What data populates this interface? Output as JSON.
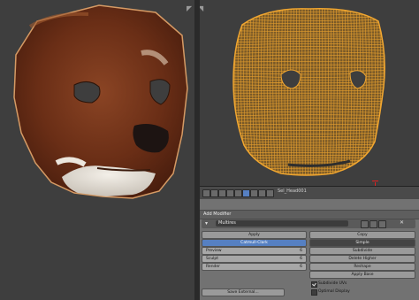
{
  "viewports": {
    "left_corner_icon": "corner-drag-icon",
    "right_corner_icon": "corner-drag-icon"
  },
  "header": {
    "object_name": "Sel_Head001"
  },
  "properties": {
    "section_title": "Add Modifier",
    "modifier": {
      "name": "Multires",
      "apply_label": "Apply",
      "copy_label": "Copy",
      "catmull_label": "Catmull-Clark",
      "simple_label": "Simple",
      "subdivide_label": "Subdivide",
      "delete_higher_label": "Delete Higher",
      "reshape_label": "Reshape",
      "apply_base_label": "Apply Base",
      "save_external_label": "Save External...",
      "levels": [
        {
          "label": "Preview",
          "value": "6"
        },
        {
          "label": "Sculpt",
          "value": "6"
        },
        {
          "label": "Render",
          "value": "6"
        }
      ],
      "subdivide_uvs_label": "Subdivide UVs",
      "subdivide_uvs_checked": true,
      "optimal_display_label": "Optimal Display",
      "optimal_display_checked": false
    }
  },
  "colors": {
    "accent": "#5680c2",
    "wireframe": "#f0a630",
    "fur": "#6a2e16",
    "cursor": "#e02020"
  }
}
